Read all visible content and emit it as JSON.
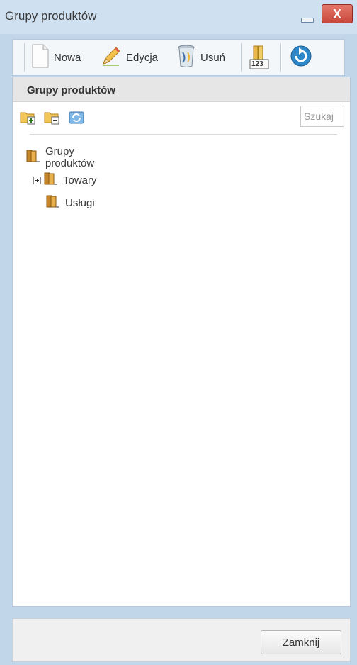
{
  "window": {
    "title": "Grupy produktów",
    "close_glyph": "X"
  },
  "toolbar": {
    "new_label": "Nowa",
    "edit_label": "Edycja",
    "delete_label": "Usuń",
    "numbering_icon_text": "123"
  },
  "panel": {
    "title": "Grupy produktów",
    "search_placeholder": "Szukaj"
  },
  "tree": {
    "root": "Grupy produktów",
    "children": [
      {
        "label": "Towary",
        "expandable": true
      },
      {
        "label": "Usługi",
        "expandable": false
      }
    ]
  },
  "footer": {
    "close_label": "Zamknij"
  },
  "colors": {
    "window_frame": "#c2d6ea",
    "close_button": "#c8473b",
    "folder": "#d29a2e"
  }
}
